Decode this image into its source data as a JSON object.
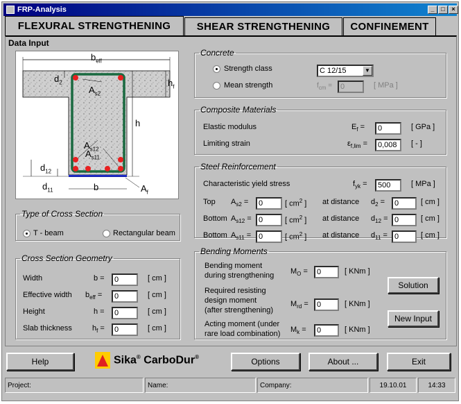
{
  "window": {
    "title": "FRP-Analysis"
  },
  "tabs": [
    "FLEXURAL STRENGTHENING",
    "SHEAR STRENGTHENING",
    "CONFINEMENT"
  ],
  "data_input_label": "Data Input",
  "diagram": {
    "beff": "b",
    "beff_sub": "eff",
    "d2": "d",
    "d2_sub": "2",
    "hf": "h",
    "hf_sub": "f",
    "As2": "A",
    "As2_sub": "s2",
    "h": "h",
    "As12": "A",
    "As12_sub": "s12",
    "As11": "A",
    "As11_sub": "s11",
    "d12": "d",
    "d12_sub": "12",
    "d11": "d",
    "d11_sub": "11",
    "b": "b",
    "Af": "A",
    "Af_sub": "f"
  },
  "cross_section_type": {
    "title": "Type of Cross Section",
    "options": [
      "T - beam",
      "Rectangular beam"
    ],
    "selected": "T - beam"
  },
  "geometry": {
    "title": "Cross Section Geometry",
    "rows": [
      {
        "label": "Width",
        "sym": "b =",
        "value": "0",
        "unit": "[ cm ]"
      },
      {
        "label": "Effective width",
        "sym": "b",
        "sym_sub": "eff",
        "sym_end": " =",
        "value": "0",
        "unit": "[ cm ]"
      },
      {
        "label": "Height",
        "sym": "h =",
        "value": "0",
        "unit": "[ cm ]"
      },
      {
        "label": "Slab thickness",
        "sym": "h",
        "sym_sub": "f",
        "sym_end": " =",
        "value": "0",
        "unit": "[ cm ]"
      }
    ]
  },
  "concrete": {
    "title": "Concrete",
    "strength_class_label": "Strength class",
    "strength_class_value": "C 12/15",
    "mean_strength_label": "Mean strength",
    "fcm_label": "f",
    "fcm_sub": "cm",
    "fcm_eq": " =",
    "fcm_value": "0",
    "fcm_unit": "[ MPa ]",
    "selected": "Strength class"
  },
  "composite": {
    "title": "Composite Materials",
    "elastic_label": "Elastic modulus",
    "ef_sym": "E",
    "ef_sub": "f",
    "ef_eq": " =",
    "ef_value": "0",
    "ef_unit": "[ GPa ]",
    "strain_label": "Limiting strain",
    "eps_sym": "ε",
    "eps_sub": "f,lim",
    "eps_eq": " =",
    "eps_value": "0,008",
    "eps_unit": "[  -  ]"
  },
  "steel": {
    "title": "Steel Reinforcement",
    "yield_label": "Characteristic yield stress",
    "fyk_sym": "f",
    "fyk_sub": "yk",
    "fyk_eq": " =",
    "fyk_value": "500",
    "fyk_unit": "[ MPa ]",
    "rows": [
      {
        "pos": "Top",
        "a": "A",
        "a_sub": "s2",
        "a_eq": " =",
        "value": "0",
        "unit": "[ cm",
        "unit_sup": "2",
        "unit_end": " ]",
        "dist": "at distance",
        "d": "d",
        "d_sub": "2",
        "d_eq": " =",
        "d_value": "0",
        "d_unit": "[ cm ]"
      },
      {
        "pos": "Bottom",
        "a": "A",
        "a_sub": "s12",
        "a_eq": " =",
        "value": "0",
        "unit": "[ cm",
        "unit_sup": "2",
        "unit_end": " ]",
        "dist": "at distance",
        "d": "d",
        "d_sub": "12",
        "d_eq": " =",
        "d_value": "0",
        "d_unit": "[ cm ]"
      },
      {
        "pos": "Bottom",
        "a": "A",
        "a_sub": "s11",
        "a_eq": " =",
        "value": "0",
        "unit": "[ cm",
        "unit_sup": "2",
        "unit_end": " ]",
        "dist": "at distance",
        "d": "d",
        "d_sub": "11",
        "d_eq": " =",
        "d_value": "0",
        "d_unit": "[ cm ]"
      }
    ]
  },
  "moments": {
    "title": "Bending Moments",
    "m0_label1": "Bending moment",
    "m0_label2": "during strengthening",
    "m0_sym": "M",
    "m0_sub": "O",
    "m0_eq": " =",
    "m0_value": "0",
    "m0_unit": "[ KNm ]",
    "mrd_label1": "Required resisting",
    "mrd_label2": "design moment",
    "mrd_label3": "(after strengthening)",
    "mrd_sym": "M",
    "mrd_sub": "rd",
    "mrd_eq": " =",
    "mrd_value": "0",
    "mrd_unit": "[ KNm ]",
    "mk_label1": "Acting moment (under",
    "mk_label2": "rare load combination)",
    "mk_sym": "M",
    "mk_sub": "k",
    "mk_eq": " =",
    "mk_value": "0",
    "mk_unit": "[ KNm ]",
    "solution_btn": "Solution",
    "newinput_btn": "New Input"
  },
  "bottom": {
    "help": "Help",
    "brand1": "Sika",
    "brand_reg": "®",
    "brand2": " CarboDur",
    "brand_reg2": "®",
    "options": "Options",
    "about": "About ...",
    "exit": "Exit"
  },
  "status": {
    "project": "Project:",
    "name": "Name:",
    "company": "Company:",
    "date": "19.10.01",
    "time": "14:33"
  },
  "colors": {
    "titlebar": "#000080",
    "rebar": "#e82020",
    "stirrup": "#1a6a40"
  }
}
